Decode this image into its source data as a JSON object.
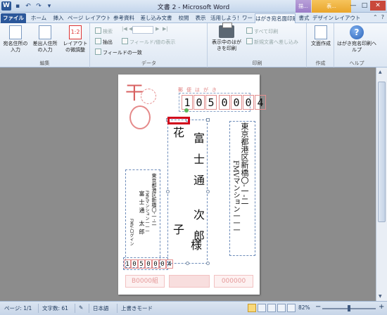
{
  "window": {
    "title": "文書 2 - Microsoft Word",
    "ctx_group_a": "描...",
    "ctx_group_b": "表...",
    "min": "—",
    "max": "□",
    "close": "✕"
  },
  "qat": {
    "undo": "↶",
    "redo": "↷",
    "dropdown": "▾"
  },
  "tabs": {
    "file": "ファイル",
    "home": "ホーム",
    "insert": "挿入",
    "page_layout": "ページ レイアウト",
    "references": "参考資料",
    "mailings": "差し込み文書",
    "review": "校閲",
    "view": "表示",
    "addins": "活用しよう！ワー",
    "postcard": "はがき宛名面印刷",
    "format": "書式",
    "design": "デザイン",
    "layout": "レイアウト"
  },
  "ribbon": {
    "edit": {
      "label": "編集",
      "recipient_btn": "宛名住所の入力",
      "sender_btn": "差出人住所の入力",
      "layout_btn": "レイアウトの微調整"
    },
    "data": {
      "label": "データ",
      "search": "検索",
      "extract": "抽出",
      "field_match": "フィールドの一致",
      "field_show": "フィールド/値の表示"
    },
    "print": {
      "label": "印刷",
      "print_postcard": "表示中のはがきを印刷",
      "print_all": "すべて印刷",
      "new_doc_merge": "新規文書へ差し込み"
    },
    "create": {
      "label": "作成",
      "doc_create": "文面作成"
    },
    "help": {
      "label": "ヘルプ",
      "postcard_help": "はがき宛名印刷ヘルプ"
    }
  },
  "card": {
    "stamp_text": "干",
    "postal_label": "郵便はがき",
    "zip": [
      "1",
      "0",
      "5",
      "0",
      "0",
      "0",
      "4"
    ],
    "first_char": "花",
    "recipient_name": "富士通 次郎",
    "child_name": "子",
    "honorific": "様",
    "address_line1": "東京都港区新橋〇-一-二",
    "address_line2": "FMVマンション一一一",
    "sender_address": "東京都港区新橋〇-一-二",
    "sender_address2": "FMVマンション一一一",
    "sender_name": "富士通 太郎",
    "sender_code": "FMV-ログイン",
    "sender_zip": [
      "1",
      "0",
      "5",
      "0",
      "0",
      "0",
      "4"
    ],
    "lottery_left": "B0000組",
    "lottery_mid": "",
    "lottery_right": "000000"
  },
  "status": {
    "page": "ページ: 1/1",
    "words": "文字数: 61",
    "language": "日本語",
    "mode": "上書きモード",
    "zoom": "82%",
    "zoom_minus": "−",
    "zoom_plus": "+"
  }
}
